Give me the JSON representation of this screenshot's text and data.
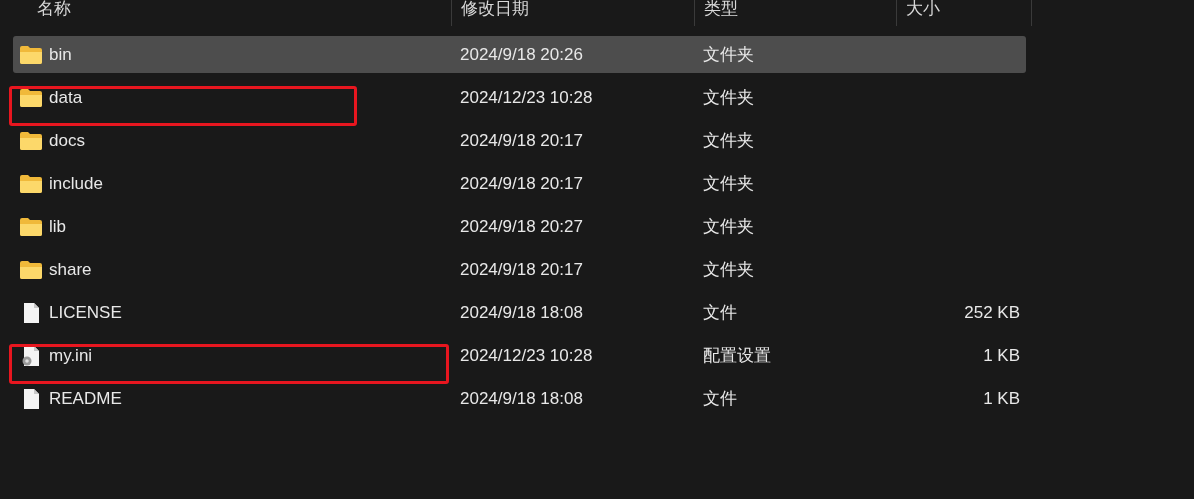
{
  "columns": [
    "名称",
    "修改日期",
    "类型",
    "大小"
  ],
  "rows": [
    {
      "kind": "folder",
      "name": "bin",
      "modified": "2024/9/18 20:26",
      "type": "文件夹",
      "selected": true,
      "framed": false
    },
    {
      "kind": "folder",
      "name": "data",
      "modified": "2024/12/23 10:28",
      "type": "文件夹",
      "selected": false,
      "framed": true
    },
    {
      "kind": "folder",
      "name": "docs",
      "modified": "2024/9/18 20:17",
      "type": "文件夹",
      "selected": false,
      "framed": false
    },
    {
      "kind": "folder",
      "name": "include",
      "modified": "2024/9/18 20:17",
      "type": "文件夹",
      "selected": false,
      "framed": false
    },
    {
      "kind": "folder",
      "name": "lib",
      "modified": "2024/9/18 20:27",
      "type": "文件夹",
      "selected": false,
      "framed": false
    },
    {
      "kind": "folder",
      "name": "share",
      "modified": "2024/9/18 20:17",
      "type": "文件夹",
      "selected": false,
      "framed": false
    },
    {
      "kind": "file",
      "name": "LICENSE",
      "modified": "2024/9/18 18:08",
      "type": "文件",
      "size": "252 KB",
      "selected": false,
      "framed": false
    },
    {
      "kind": "config",
      "name": "my.ini",
      "modified": "2024/12/23 10:28",
      "type": "配置设置",
      "size": "1 KB",
      "selected": false,
      "framed": true
    },
    {
      "kind": "file",
      "name": "README",
      "modified": "2024/9/18 18:08",
      "type": "文件",
      "size": "1 KB",
      "selected": false,
      "framed": false
    }
  ]
}
